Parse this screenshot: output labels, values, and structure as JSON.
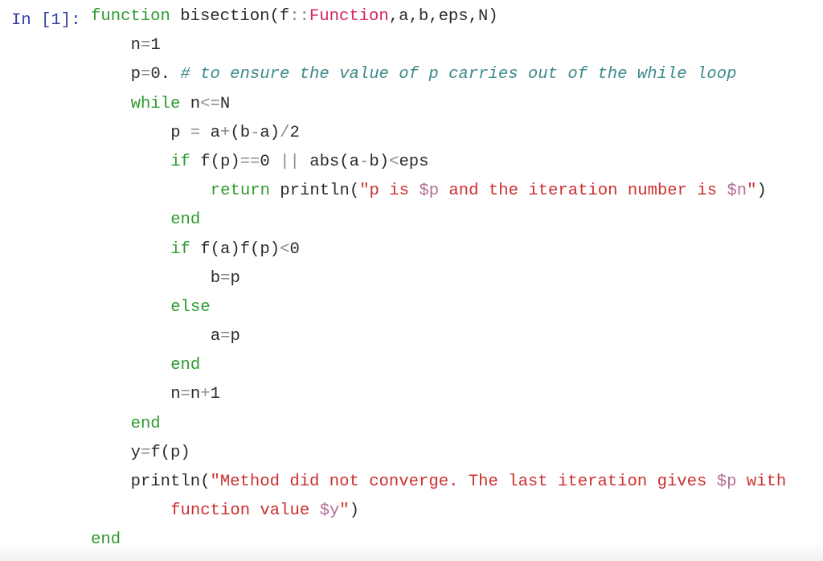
{
  "cell": {
    "prompt": "In [1]:",
    "language": "julia"
  },
  "colors": {
    "prompt": "#303f9f",
    "keyword": "#2e9a2e",
    "type": "#d6255a",
    "string": "#cc2f2f",
    "interpolation": "#b56e95",
    "comment": "#3d8a8a",
    "operator": "#8a8a8a",
    "text": "#2b2b2b"
  },
  "code_lines": [
    {
      "indent": 0,
      "tokens": [
        {
          "t": "kw",
          "v": "function"
        },
        {
          "t": "tx",
          "v": " bisection(f"
        },
        {
          "t": "op",
          "v": "::"
        },
        {
          "t": "ty",
          "v": "Function"
        },
        {
          "t": "tx",
          "v": ",a,b,eps,N)"
        }
      ]
    },
    {
      "indent": 1,
      "tokens": [
        {
          "t": "tx",
          "v": "n"
        },
        {
          "t": "op",
          "v": "="
        },
        {
          "t": "tx",
          "v": "1"
        }
      ]
    },
    {
      "indent": 1,
      "tokens": [
        {
          "t": "tx",
          "v": "p"
        },
        {
          "t": "op",
          "v": "="
        },
        {
          "t": "tx",
          "v": "0. "
        },
        {
          "t": "cm",
          "v": "# to ensure the value of p carries out of the while loop"
        }
      ]
    },
    {
      "indent": 1,
      "tokens": [
        {
          "t": "kw",
          "v": "while"
        },
        {
          "t": "tx",
          "v": " n"
        },
        {
          "t": "op",
          "v": "<="
        },
        {
          "t": "tx",
          "v": "N"
        }
      ]
    },
    {
      "indent": 2,
      "tokens": [
        {
          "t": "tx",
          "v": "p "
        },
        {
          "t": "op",
          "v": "="
        },
        {
          "t": "tx",
          "v": " a"
        },
        {
          "t": "op",
          "v": "+"
        },
        {
          "t": "tx",
          "v": "(b"
        },
        {
          "t": "op",
          "v": "-"
        },
        {
          "t": "tx",
          "v": "a)"
        },
        {
          "t": "op",
          "v": "/"
        },
        {
          "t": "tx",
          "v": "2"
        }
      ]
    },
    {
      "indent": 2,
      "tokens": [
        {
          "t": "kw",
          "v": "if"
        },
        {
          "t": "tx",
          "v": " f(p)"
        },
        {
          "t": "op",
          "v": "=="
        },
        {
          "t": "tx",
          "v": "0 "
        },
        {
          "t": "op",
          "v": "||"
        },
        {
          "t": "tx",
          "v": " abs(a"
        },
        {
          "t": "op",
          "v": "-"
        },
        {
          "t": "tx",
          "v": "b)"
        },
        {
          "t": "op",
          "v": "<"
        },
        {
          "t": "tx",
          "v": "eps"
        }
      ]
    },
    {
      "indent": 3,
      "tokens": [
        {
          "t": "kw",
          "v": "return"
        },
        {
          "t": "tx",
          "v": " println("
        },
        {
          "t": "str",
          "v": "\"p is "
        },
        {
          "t": "interp",
          "v": "$p"
        },
        {
          "t": "str",
          "v": " and the iteration number is "
        },
        {
          "t": "interp",
          "v": "$n"
        },
        {
          "t": "str",
          "v": "\""
        },
        {
          "t": "tx",
          "v": ")"
        }
      ]
    },
    {
      "indent": 2,
      "tokens": [
        {
          "t": "kw",
          "v": "end"
        }
      ]
    },
    {
      "indent": 2,
      "tokens": [
        {
          "t": "kw",
          "v": "if"
        },
        {
          "t": "tx",
          "v": " f(a)f(p)"
        },
        {
          "t": "op",
          "v": "<"
        },
        {
          "t": "tx",
          "v": "0"
        }
      ]
    },
    {
      "indent": 3,
      "tokens": [
        {
          "t": "tx",
          "v": "b"
        },
        {
          "t": "op",
          "v": "="
        },
        {
          "t": "tx",
          "v": "p"
        }
      ]
    },
    {
      "indent": 2,
      "tokens": [
        {
          "t": "kw",
          "v": "else"
        }
      ]
    },
    {
      "indent": 3,
      "tokens": [
        {
          "t": "tx",
          "v": "a"
        },
        {
          "t": "op",
          "v": "="
        },
        {
          "t": "tx",
          "v": "p"
        }
      ]
    },
    {
      "indent": 2,
      "tokens": [
        {
          "t": "kw",
          "v": "end"
        }
      ]
    },
    {
      "indent": 2,
      "tokens": [
        {
          "t": "tx",
          "v": "n"
        },
        {
          "t": "op",
          "v": "="
        },
        {
          "t": "tx",
          "v": "n"
        },
        {
          "t": "op",
          "v": "+"
        },
        {
          "t": "tx",
          "v": "1"
        }
      ]
    },
    {
      "indent": 1,
      "tokens": [
        {
          "t": "kw",
          "v": "end"
        }
      ]
    },
    {
      "indent": 1,
      "tokens": [
        {
          "t": "tx",
          "v": "y"
        },
        {
          "t": "op",
          "v": "="
        },
        {
          "t": "tx",
          "v": "f(p)"
        }
      ]
    },
    {
      "indent": 1,
      "tokens": [
        {
          "t": "tx",
          "v": "println("
        },
        {
          "t": "str",
          "v": "\"Method did not converge. The last iteration gives "
        },
        {
          "t": "interp",
          "v": "$p"
        },
        {
          "t": "str",
          "v": " with"
        }
      ]
    },
    {
      "indent": 2,
      "tokens": [
        {
          "t": "str",
          "v": "function value "
        },
        {
          "t": "interp",
          "v": "$y"
        },
        {
          "t": "str",
          "v": "\""
        },
        {
          "t": "tx",
          "v": ")"
        }
      ]
    },
    {
      "indent": 0,
      "tokens": [
        {
          "t": "kw",
          "v": "end"
        }
      ]
    }
  ]
}
